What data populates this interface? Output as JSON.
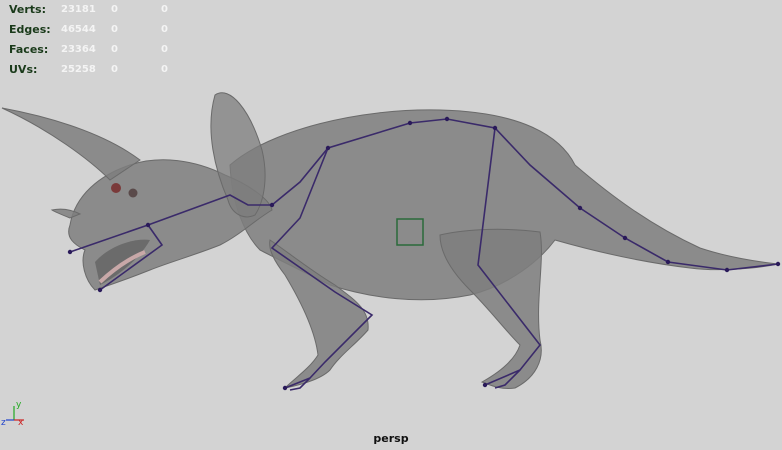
{
  "hud": {
    "rows": [
      {
        "label": "Verts:",
        "value": "23181",
        "sel": "0",
        "extra": "0"
      },
      {
        "label": "Edges:",
        "value": "46544",
        "sel": "0",
        "extra": "0"
      },
      {
        "label": "Faces:",
        "value": "23364",
        "sel": "0",
        "extra": "0"
      },
      {
        "label": "UVs:",
        "value": "25258",
        "sel": "0",
        "extra": "0"
      }
    ]
  },
  "viewport": {
    "camera": "persp",
    "background": "#d3d3d3"
  },
  "axis_indicator": {
    "y": "y",
    "z": "z",
    "x": "x"
  },
  "colors": {
    "mesh": "#8a8a8a",
    "joint": "#3a2a6a",
    "manipulator": "#2a6a3a",
    "axis_x": "#cc2222",
    "axis_y": "#22aa22",
    "axis_z": "#2244cc"
  }
}
